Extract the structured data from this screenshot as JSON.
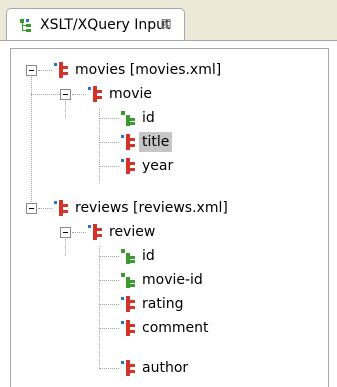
{
  "tab": {
    "title": "XSLT/XQuery Input",
    "close_glyph": "⊠"
  },
  "tree": [
    {
      "label": "movies [movies.xml]",
      "icon": "element-icon",
      "expanded": true
    },
    {
      "label": "movie",
      "icon": "element-icon",
      "expanded": true
    },
    {
      "label": "id",
      "icon": "attribute-icon"
    },
    {
      "label": "title",
      "icon": "element-icon",
      "selected": true
    },
    {
      "label": "year",
      "icon": "element-icon"
    },
    {
      "label": "reviews [reviews.xml]",
      "icon": "element-icon",
      "expanded": true
    },
    {
      "label": "review",
      "icon": "element-icon",
      "expanded": true
    },
    {
      "label": "id",
      "icon": "attribute-icon"
    },
    {
      "label": "movie-id",
      "icon": "attribute-icon"
    },
    {
      "label": "rating",
      "icon": "element-icon"
    },
    {
      "label": "comment",
      "icon": "element-icon"
    },
    {
      "label": "author",
      "icon": "element-icon"
    }
  ],
  "colors": {
    "element_red": "#d2342a",
    "element_blue": "#2a6fd6",
    "attribute_green": "#3a9a2e"
  }
}
